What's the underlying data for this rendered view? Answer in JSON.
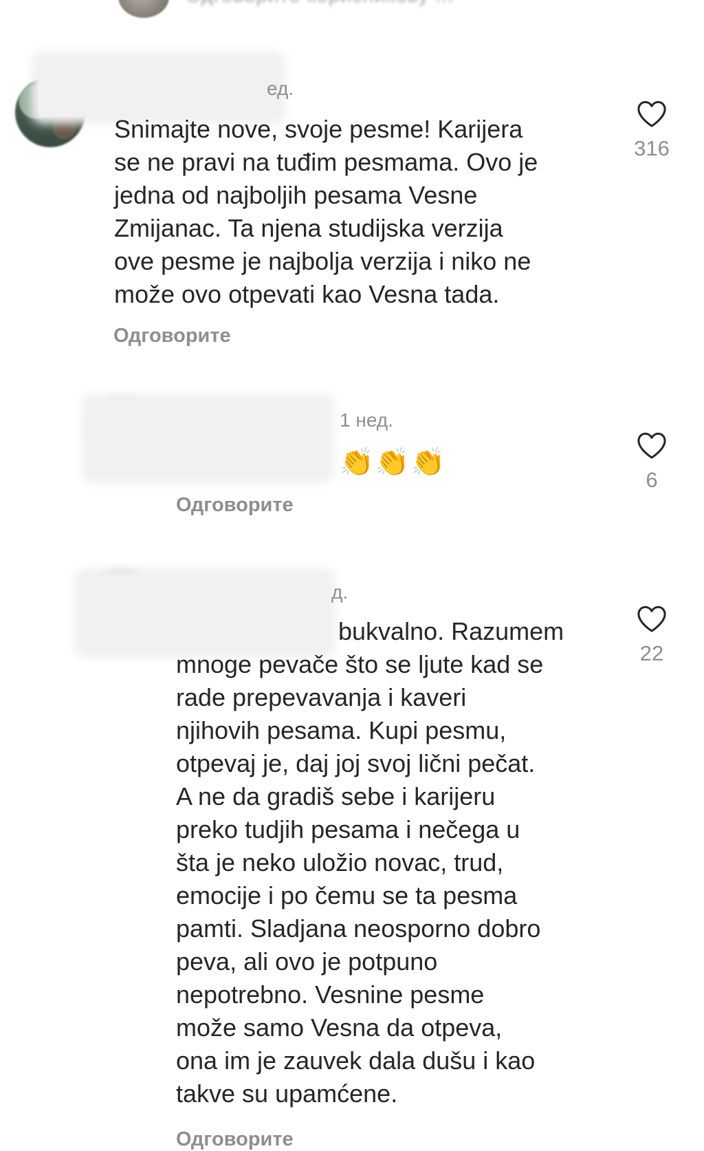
{
  "top_partial": {
    "text": "Одговорите корисникову ..."
  },
  "comments": [
    {
      "time": "ед.",
      "text_lines": [
        "Snimajte nove, svoje pesme! Karijera",
        "se ne pravi na tuđim pesmama. Ovo je",
        "jedna od najboljih pesama Vesne",
        "Zmijanac. Ta njena studijska verzija",
        "ove pesme je najbolja verzija i niko ne",
        "može ovo otpevati kao Vesna tada."
      ],
      "reply_label": "Одговорите",
      "likes": "316"
    },
    {
      "time": "1 нед.",
      "emoji": "👏👏👏",
      "reply_label": "Одговорите",
      "likes": "6"
    },
    {
      "time": "д.",
      "first_line": "bukvalno. Razumem",
      "text_lines": [
        "mnoge pevače što se ljute kad se",
        "rade prepevavanja i kaveri",
        "njihovih pesama. Kupi pesmu,",
        "otpevaj je, daj joj svoj lični pečat.",
        "A ne da gradiš sebe i karijeru",
        "preko tudjih pesama i nečega u",
        "šta je neko uložio novac, trud,",
        "emocije i po čemu se ta pesma",
        "pamti. Sladjana neosporno dobro",
        "peva, ali ovo je potpuno",
        "nepotrebno. Vesnine pesme",
        "može samo Vesna da otpeva,",
        "ona im je zauvek dala dušu i kao",
        "takve su upamćene."
      ],
      "reply_label": "Одговорите",
      "likes": "22"
    }
  ],
  "icons": {
    "like": "heart-outline-icon",
    "color_stroke": "#262626",
    "color_meta": "#8e8e8e"
  }
}
